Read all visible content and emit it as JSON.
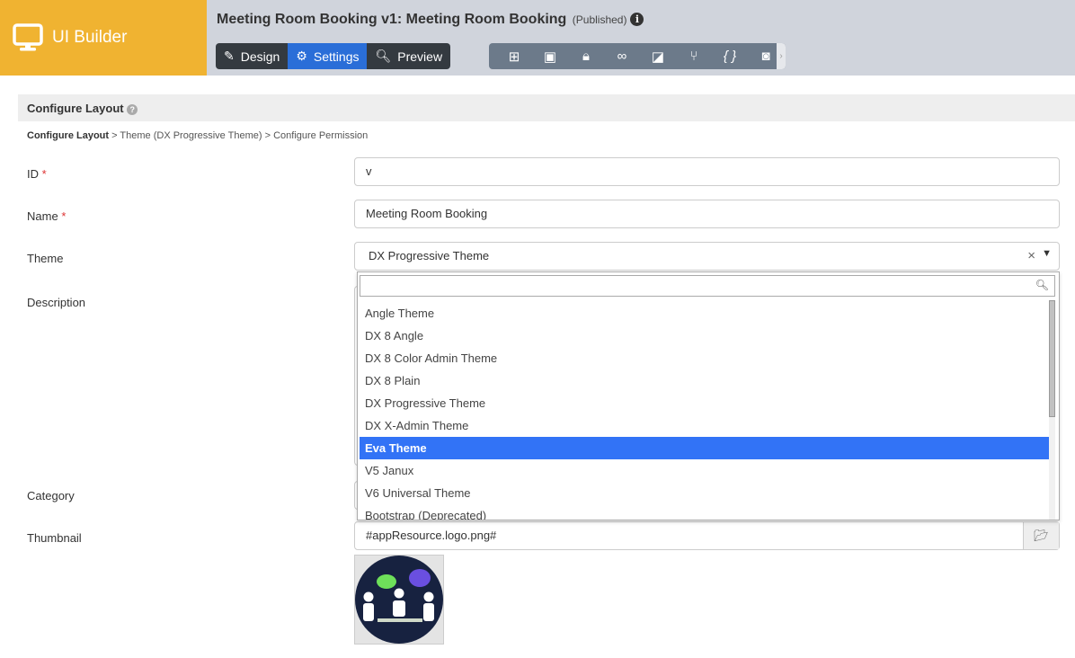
{
  "app": {
    "name": "UI Builder"
  },
  "header": {
    "title": "Meeting Room Booking v1: Meeting Room Booking",
    "status": "(Published)"
  },
  "tabs": [
    {
      "label": "Design"
    },
    {
      "label": "Settings"
    },
    {
      "label": "Preview"
    }
  ],
  "section": {
    "title": "Configure Layout"
  },
  "breadcrumb": {
    "current": "Configure Layout",
    "sep": ">",
    "step2": "Theme (DX Progressive Theme)",
    "step3": "Configure Permission"
  },
  "form": {
    "id_label": "ID",
    "id_value": "v",
    "name_label": "Name",
    "name_value": "Meeting Room Booking",
    "theme_label": "Theme",
    "theme_value": "DX Progressive Theme",
    "description_label": "Description",
    "category_label": "Category",
    "thumbnail_label": "Thumbnail",
    "thumbnail_value": "#appResource.logo.png#",
    "required": "*"
  },
  "theme_options": [
    "Angle Theme",
    "DX 8 Angle",
    "DX 8 Color Admin Theme",
    "DX 8 Plain",
    "DX Progressive Theme",
    "DX X-Admin Theme",
    "Eva Theme",
    "V5 Janux",
    "V6 Universal Theme",
    "Bootstrap (Deprecated)"
  ],
  "highlighted_option": "Eva Theme"
}
